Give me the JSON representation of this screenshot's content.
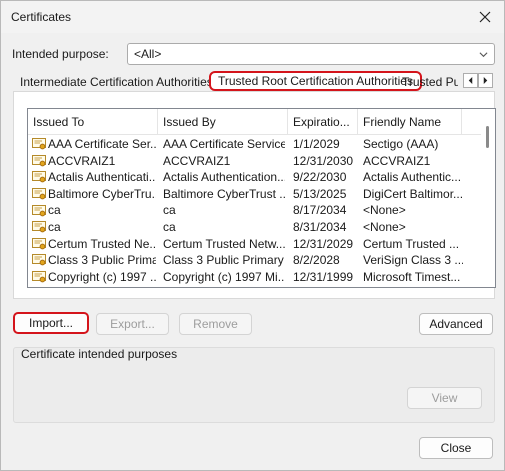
{
  "window": {
    "title": "Certificates",
    "close_icon": "close-icon"
  },
  "purpose": {
    "label": "Intended purpose:",
    "value": "<All>"
  },
  "tabs": [
    {
      "label": "Intermediate Certification Authorities"
    },
    {
      "label": "Trusted Root Certification Authorities"
    },
    {
      "label": "Trusted Publishers"
    }
  ],
  "list": {
    "columns": [
      "Issued To",
      "Issued By",
      "Expiratio...",
      "Friendly Name"
    ],
    "rows": [
      [
        "AAA Certificate Ser...",
        "AAA Certificate Services",
        "1/1/2029",
        "Sectigo (AAA)"
      ],
      [
        "ACCVRAIZ1",
        "ACCVRAIZ1",
        "12/31/2030",
        "ACCVRAIZ1"
      ],
      [
        "Actalis Authenticati...",
        "Actalis Authentication...",
        "9/22/2030",
        "Actalis Authentic..."
      ],
      [
        "Baltimore CyberTru...",
        "Baltimore CyberTrust ...",
        "5/13/2025",
        "DigiCert Baltimor..."
      ],
      [
        "ca",
        "ca",
        "8/17/2034",
        "<None>"
      ],
      [
        "ca",
        "ca",
        "8/31/2034",
        "<None>"
      ],
      [
        "Certum Trusted Ne...",
        "Certum Trusted Netw...",
        "12/31/2029",
        "Certum Trusted ..."
      ],
      [
        "Class 3 Public Prima...",
        "Class 3 Public Primary ...",
        "8/2/2028",
        "VeriSign Class 3 ..."
      ],
      [
        "Copyright (c) 1997 ...",
        "Copyright (c) 1997 Mi...",
        "12/31/1999",
        "Microsoft Timest..."
      ]
    ]
  },
  "buttons": {
    "import": "Import...",
    "export": "Export...",
    "remove": "Remove",
    "advanced": "Advanced",
    "view": "View",
    "close": "Close"
  },
  "purposes_group": {
    "title": "Certificate intended purposes"
  }
}
